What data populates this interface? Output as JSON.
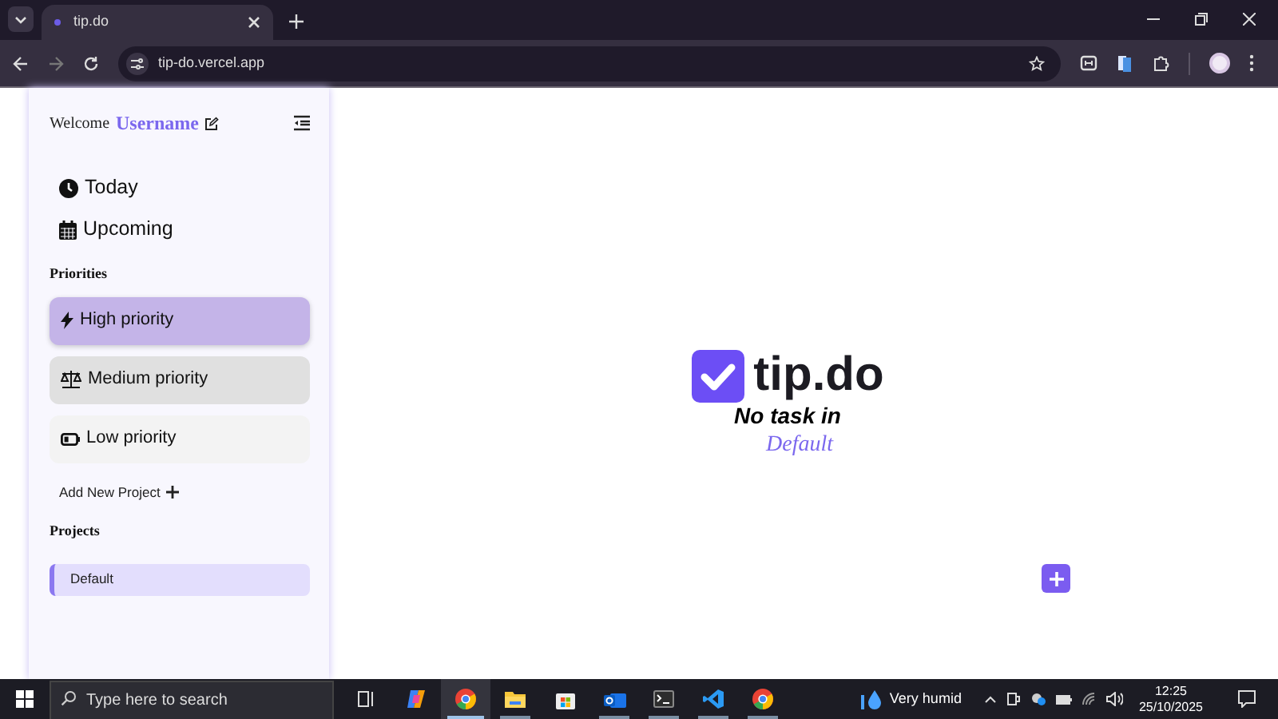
{
  "browser": {
    "tab_title": "tip.do",
    "url": "tip-do.vercel.app"
  },
  "sidebar": {
    "welcome": "Welcome",
    "username": "Username",
    "nav": [
      {
        "kind": "today",
        "label": "Today"
      },
      {
        "kind": "upcoming",
        "label": "Upcoming"
      }
    ],
    "priorities_heading": "Priorities",
    "priorities": [
      {
        "kind": "high",
        "label": "High priority",
        "selected": true
      },
      {
        "kind": "medium",
        "label": "Medium priority",
        "selected": false
      },
      {
        "kind": "low",
        "label": "Low priority",
        "selected": false
      }
    ],
    "add_project": "Add New Project",
    "projects_heading": "Projects",
    "projects": [
      {
        "label": "Default",
        "selected": true
      }
    ]
  },
  "main": {
    "logo_text": "tip.do",
    "empty_message": "No task in",
    "project_name": "Default"
  },
  "taskbar": {
    "search_placeholder": "Type here to search",
    "apps": [
      {
        "kind": "taskview",
        "running": false,
        "selected": false
      },
      {
        "kind": "copilot",
        "running": false,
        "selected": false
      },
      {
        "kind": "chrome",
        "running": true,
        "selected": true
      },
      {
        "kind": "explorer",
        "running": true,
        "selected": false
      },
      {
        "kind": "store",
        "running": false,
        "selected": false
      },
      {
        "kind": "outlook",
        "running": true,
        "selected": false
      },
      {
        "kind": "terminal",
        "running": true,
        "selected": false
      },
      {
        "kind": "vscode",
        "running": true,
        "selected": false
      },
      {
        "kind": "chrome",
        "running": true,
        "selected": false
      }
    ],
    "weather": "Very humid",
    "time": "12:25",
    "date": "25/10/2025"
  }
}
